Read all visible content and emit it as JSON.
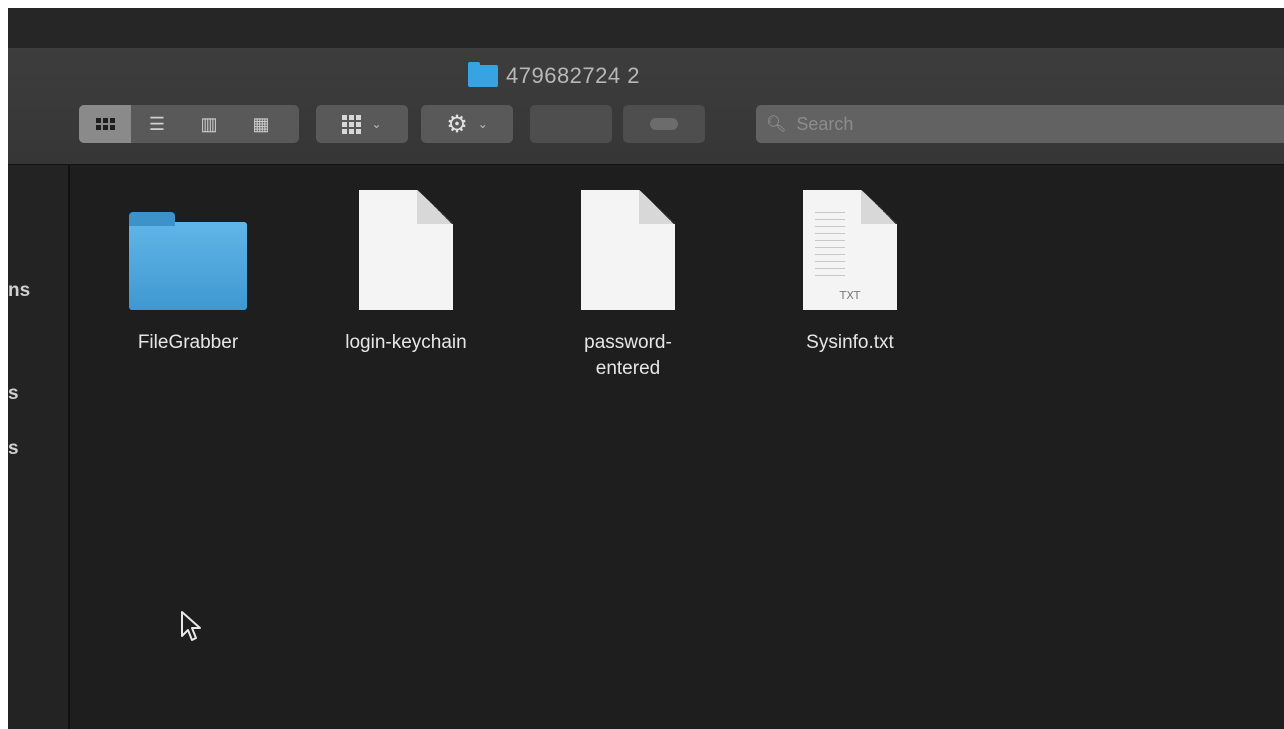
{
  "window": {
    "title": "479682724 2"
  },
  "toolbar": {
    "view_modes": [
      "icon-view",
      "list-view",
      "column-view",
      "gallery-view"
    ],
    "group_icon": "grid-group-icon",
    "action_icon": "gear-icon",
    "share_icon": "share-icon",
    "tag_icon": "tag-icon",
    "search_placeholder": "Search"
  },
  "sidebar": {
    "items": [
      {
        "label": "ns"
      },
      {
        "label": "s"
      },
      {
        "label": "s"
      }
    ]
  },
  "files": [
    {
      "name": "FileGrabber",
      "kind": "folder"
    },
    {
      "name": "login-keychain",
      "kind": "document"
    },
    {
      "name": "password-entered",
      "kind": "document"
    },
    {
      "name": "Sysinfo.txt",
      "kind": "text",
      "ext": "TXT"
    }
  ],
  "colors": {
    "background": "#1e1e1e",
    "folder": "#4aa8e0",
    "toolbar": "#3a3a3a"
  }
}
